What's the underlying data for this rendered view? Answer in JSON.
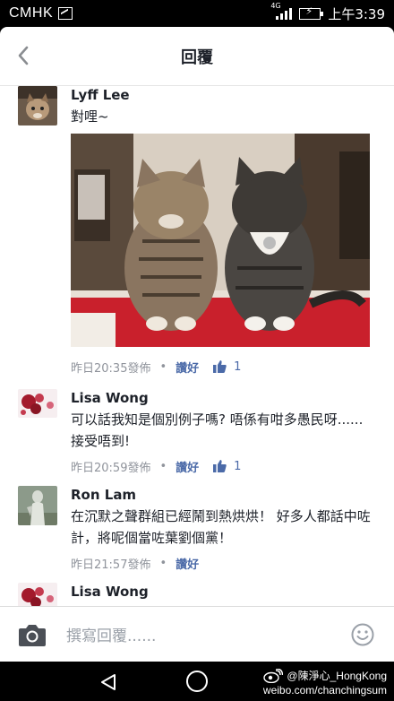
{
  "status_bar": {
    "carrier": "CMHK",
    "network": "4G",
    "time": "上午3:39"
  },
  "header": {
    "title": "回覆",
    "back_icon": "chevron-left-icon"
  },
  "comments": [
    {
      "name": "Lyff Lee",
      "text": "對哩~",
      "has_photo": true,
      "time": "昨日20:35發佈",
      "like_label": "讚好",
      "like_count": "1"
    },
    {
      "name": "Lisa Wong",
      "text": "可以話我知是個別例子嗎? 唔係有咁多愚民呀......接受唔到!",
      "time": "昨日20:59發佈",
      "like_label": "讚好",
      "like_count": "1"
    },
    {
      "name": "Ron Lam",
      "text": "在沉默之聲群組已經鬧到熱烘烘！ 好多人都話中咗計，將呢個當咗葉劉個黨！",
      "time": "昨日21:57發佈",
      "like_label": "讚好",
      "like_count": ""
    },
    {
      "name": "Lisa Wong",
      "text": ""
    }
  ],
  "composer": {
    "placeholder": "撰寫回覆......"
  },
  "watermark": {
    "line1": "@陳淨心_HongKong",
    "line2": "weibo.com/chanchingsum"
  },
  "colors": {
    "like_blue": "#4b6aa8",
    "meta_gray": "#90949c",
    "text_dark": "#1d2129"
  }
}
